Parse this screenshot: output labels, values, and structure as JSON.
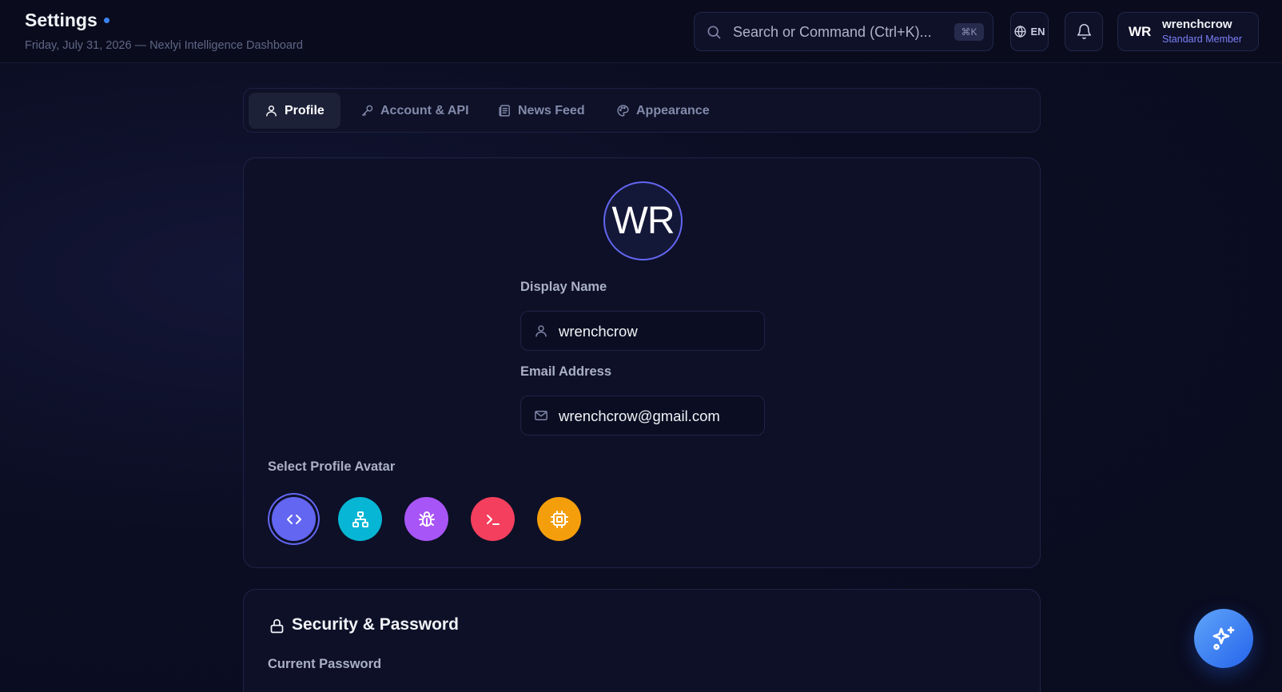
{
  "header": {
    "title": "Settings",
    "subtitle": "Friday, July 31, 2026 — Nexlyi Intelligence Dashboard",
    "search_placeholder": "Search or Command (Ctrl+K)...",
    "shortcut": "⌘K",
    "language": "EN",
    "user": {
      "initials": "WR",
      "name": "wrenchcrow",
      "role": "Standard Member"
    }
  },
  "tabs": [
    {
      "label": "Profile",
      "icon": "user-icon",
      "active": true
    },
    {
      "label": "Account & API",
      "icon": "key-icon",
      "active": false
    },
    {
      "label": "News Feed",
      "icon": "newspaper-icon",
      "active": false
    },
    {
      "label": "Appearance",
      "icon": "palette-icon",
      "active": false
    }
  ],
  "profile": {
    "avatar_initials": "WR",
    "display_name_label": "Display Name",
    "display_name_value": "wrenchcrow",
    "email_label": "Email Address",
    "email_value": "wrenchcrow@gmail.com",
    "avatar_section_label": "Select Profile Avatar",
    "avatar_options": [
      {
        "icon": "code-icon",
        "color": "#6366f1",
        "selected": true
      },
      {
        "icon": "network-icon",
        "color": "#06b6d4",
        "selected": false
      },
      {
        "icon": "bug-icon",
        "color": "#a855f7",
        "selected": false
      },
      {
        "icon": "terminal-icon",
        "color": "#f43f5e",
        "selected": false
      },
      {
        "icon": "cpu-icon",
        "color": "#f59e0b",
        "selected": false
      }
    ]
  },
  "security": {
    "title": "Security & Password",
    "current_password_label": "Current Password"
  },
  "colors": {
    "accent": "#6366f1",
    "background": "#0b0d22",
    "fab": "#3b82f6"
  }
}
